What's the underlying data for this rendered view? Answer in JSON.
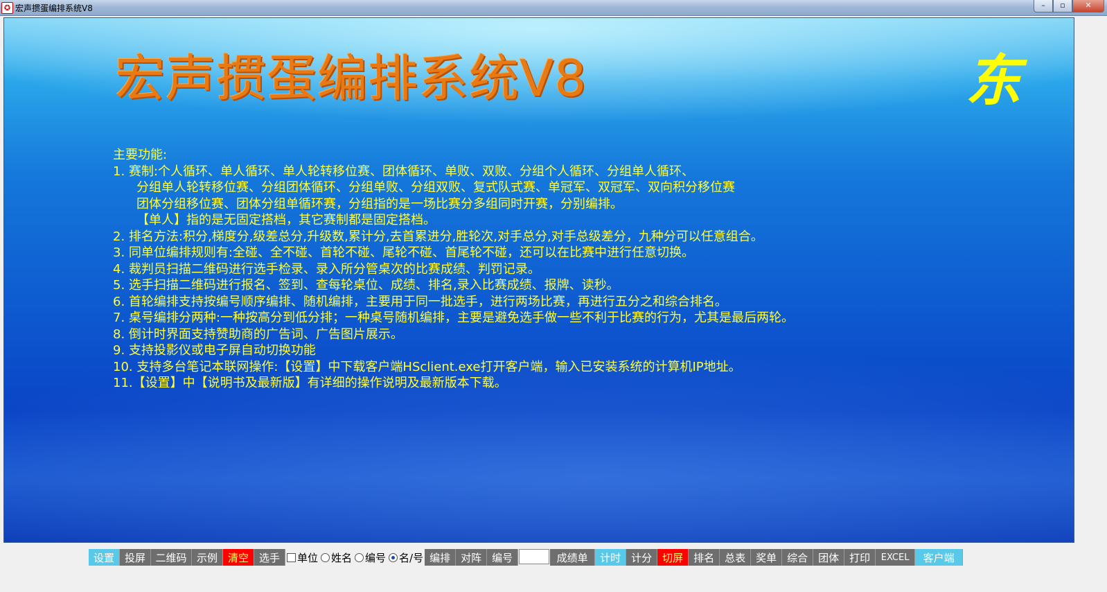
{
  "window": {
    "title": "宏声掼蛋编排系统V8",
    "controls": {
      "minimize": "–",
      "maximize": "▫",
      "close": "✕"
    }
  },
  "main": {
    "big_title": "宏声掼蛋编排系统V8",
    "corner_char": "东",
    "features": [
      "主要功能:",
      "1.  赛制:个人循环、单人循环、单人轮转移位赛、团体循环、单败、双败、分组个人循环、分组单人循环、",
      "分组单人轮转移位赛、分组团体循环、分组单败、分组双败、复式队式赛、单冠军、双冠军、双向积分移位赛",
      "团体分组移位赛、团体分组单循环赛，分组指的是一场比赛分多组同时开赛，分别编排。",
      "【单人】指的是无固定搭档，其它赛制都是固定搭档。",
      "2.  排名方法:积分,梯度分,级差总分,升级数,累计分,去首累进分,胜轮次,对手总分,对手总级差分，九种分可以任意组合。",
      "3.  同单位编排规则有:全碰、全不碰、首轮不碰、尾轮不碰、首尾轮不碰，还可以在比赛中进行任意切换。",
      "4.  裁判员扫描二维码进行选手检录、录入所分管桌次的比赛成绩、判罚记录。",
      "5.  选手扫描二维码进行报名、签到、查每轮桌位、成绩、排名,录入比赛成绩、报牌、读秒。",
      "6.  首轮编排支持按编号顺序编排、随机编排，主要用于同一批选手，进行两场比赛，再进行五分之和综合排名。",
      "7.  桌号编排分两种:一种按高分到低分排；一种桌号随机编排，主要是避免选手做一些不利于比赛的行为，尤其是最后两轮。",
      "8.  倒计时界面支持赞助商的广告词、广告图片展示。",
      "9.  支持投影仪或电子屏自动切换功能",
      "10.  支持多台笔记本联网操作:【设置】中下载客户端HSclient.exe打开客户端，输入已安装系统的计算机IP地址。",
      "11.【设置】中【说明书及最新版】有详细的操作说明及最新版本下载。"
    ]
  },
  "toolbar": {
    "settings": "设置",
    "project": "投屏",
    "qrcode": "二维码",
    "example": "示例",
    "clear": "清空",
    "players": "选手",
    "unit_label": "单位",
    "name_label": "姓名",
    "number_label": "编号",
    "namenum_label": "名/号",
    "arrange": "编排",
    "matchup": "对阵",
    "number_btn": "编号",
    "number_input_value": "",
    "score_sheet": "成绩单",
    "timer": "计时",
    "scoring": "计分",
    "switch_screen": "切屏",
    "ranking": "排名",
    "summary": "总表",
    "award": "奖单",
    "combined": "综合",
    "team": "团体",
    "print": "打印",
    "excel": "EXCEL",
    "client": "客户端"
  },
  "colors": {
    "title_orange": "#e87a16",
    "feature_yellow": "#ffff3a",
    "accent_cyan": "#58c9e8",
    "accent_red": "#ff0000"
  }
}
